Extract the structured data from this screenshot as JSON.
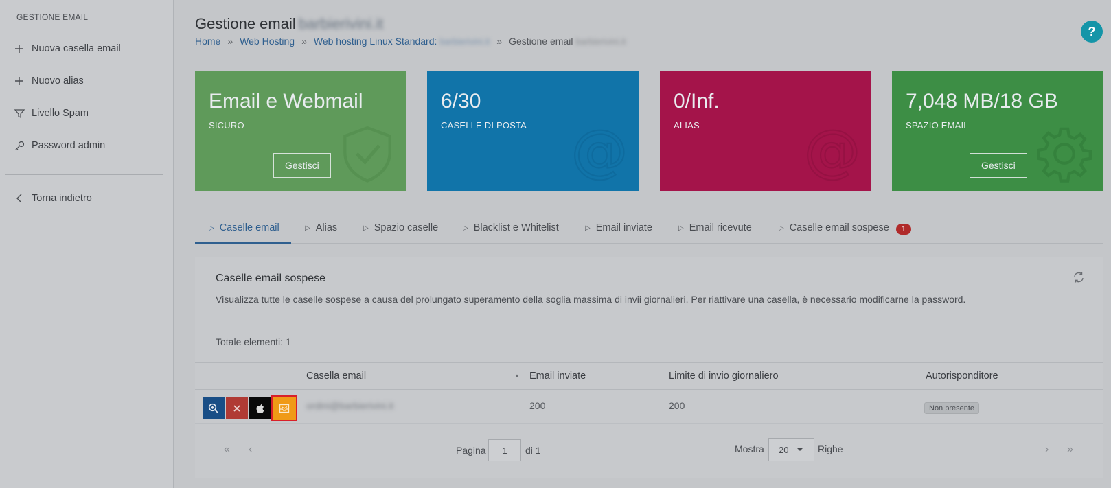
{
  "sidebar": {
    "title": "GESTIONE EMAIL",
    "items": [
      {
        "label": "Nuova casella email",
        "icon": "plus-icon"
      },
      {
        "label": "Nuovo alias",
        "icon": "plus-icon"
      },
      {
        "label": "Livello Spam",
        "icon": "filter-icon"
      },
      {
        "label": "Password admin",
        "icon": "key-icon"
      }
    ],
    "back_label": "Torna indietro"
  },
  "header": {
    "title": "Gestione email",
    "title_blurred": "barbierivini.it",
    "breadcrumb": {
      "home": "Home",
      "hosting": "Web Hosting",
      "plan": "Web hosting Linux Standard:",
      "plan_blurred": "barbierivini.it",
      "current": "Gestione email",
      "current_blurred": "barbierivini.it",
      "separator": "»"
    },
    "help": "?"
  },
  "cards": [
    {
      "big": "Email e Webmail",
      "sub": "SICURO",
      "button": "Gestisci",
      "color": "#5f9a5a",
      "icon": "shield-check-icon"
    },
    {
      "big": "6/30",
      "sub": "CASELLE DI POSTA",
      "color": "#1174a9",
      "icon": "at-icon"
    },
    {
      "big": "0/Inf.",
      "sub": "ALIAS",
      "color": "#a4144a",
      "icon": "at-icon"
    },
    {
      "big": "7,048 MB/18 GB",
      "sub": "SPAZIO EMAIL",
      "button": "Gestisci",
      "color": "#3d8e45",
      "icon": "gear-icon"
    }
  ],
  "tabs": [
    {
      "label": "Caselle email",
      "active": true
    },
    {
      "label": "Alias"
    },
    {
      "label": "Spazio caselle"
    },
    {
      "label": "Blacklist e Whitelist"
    },
    {
      "label": "Email inviate"
    },
    {
      "label": "Email ricevute"
    },
    {
      "label": "Caselle email sospese",
      "badge": "1"
    }
  ],
  "panel": {
    "title": "Caselle email sospese",
    "description": "Visualizza tutte le caselle sospese a causa del prolungato superamento della soglia massima di invii giornalieri. Per riattivare una casella, è necessario modificarne la password.",
    "total": "Totale elementi: 1",
    "columns": [
      "Casella email",
      "Email inviate",
      "Limite di invio giornaliero",
      "Autorisponditore"
    ],
    "rows": [
      {
        "email": "ordini@barbierivini.it",
        "sent": "200",
        "limit": "200",
        "autoresponder": "Non presente"
      }
    ],
    "action_colors": {
      "zoom": "#194e86",
      "delete": "#b03a34",
      "apple": "#0a0a0a",
      "mail": "#f09a16"
    },
    "pager": {
      "first": "«",
      "prev": "‹",
      "next": "›",
      "last": "»",
      "page_label": "Pagina",
      "page_value": "1",
      "of_label": "di 1",
      "show_label": "Mostra",
      "rows_value": "20",
      "rows_label": "Righe"
    }
  }
}
